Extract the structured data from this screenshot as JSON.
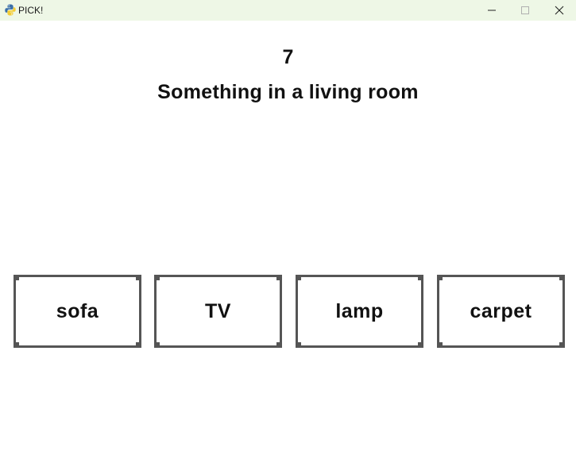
{
  "window": {
    "title": "PICK!",
    "app_icon": "python-icon"
  },
  "game": {
    "counter": "7",
    "prompt": "Something in a living room",
    "choices": [
      {
        "label": "sofa"
      },
      {
        "label": "TV"
      },
      {
        "label": "lamp"
      },
      {
        "label": "carpet"
      }
    ]
  },
  "colors": {
    "titlebar_bg": "#eef7e6",
    "button_border": "#555555",
    "text": "#111111"
  }
}
